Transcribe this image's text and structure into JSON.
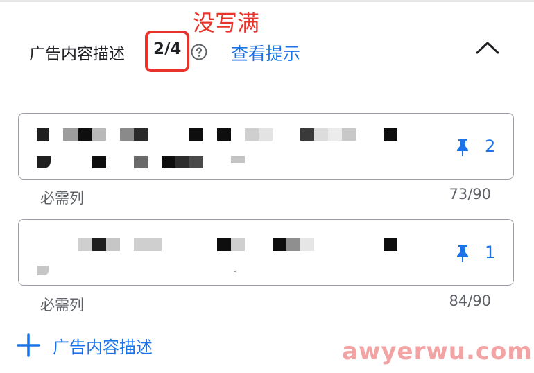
{
  "section": {
    "title": "广告内容描述",
    "counter": "2/4",
    "annotation": "没写满",
    "view_tips": "查看提示"
  },
  "descriptions": [
    {
      "pin_number": "2",
      "required_label": "必需列",
      "char_count": "73/90"
    },
    {
      "pin_number": "1",
      "required_label": "必需列",
      "char_count": "84/90"
    }
  ],
  "add_button": {
    "label": "广告内容描述"
  },
  "watermark": "awyerwu.com",
  "colors": {
    "accent": "#1a73e8",
    "annotation": "#e8332a",
    "text": "#202124",
    "muted": "#5f6368"
  }
}
